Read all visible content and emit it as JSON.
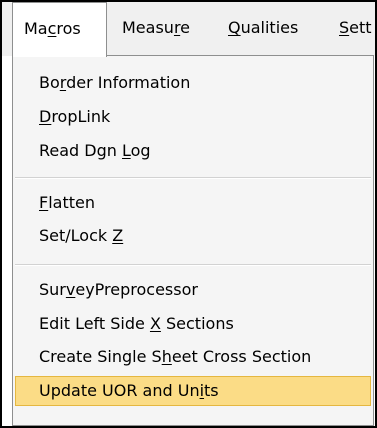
{
  "menubar": {
    "tabs": [
      {
        "pre": "Ma",
        "key": "c",
        "post": "ros"
      },
      {
        "pre": "Measu",
        "key": "r",
        "post": "e"
      },
      {
        "pre": "",
        "key": "Q",
        "post": "ualities"
      },
      {
        "pre": "",
        "key": "S",
        "post": "ett"
      }
    ]
  },
  "dropdown": {
    "items": [
      {
        "pre": "Bo",
        "key": "r",
        "post": "der Information"
      },
      {
        "pre": "",
        "key": "D",
        "post": "ropLink"
      },
      {
        "pre": "Read Dgn ",
        "key": "L",
        "post": "og"
      },
      {
        "pre": "",
        "key": "F",
        "post": "latten"
      },
      {
        "pre": "Set/Lock ",
        "key": "Z",
        "post": ""
      },
      {
        "pre": "Sur",
        "key": "v",
        "post": "eyPreprocessor"
      },
      {
        "pre": "Edit Left Side ",
        "key": "X",
        "post": " Sections"
      },
      {
        "pre": "Create Single S",
        "key": "h",
        "post": "eet Cross Section"
      },
      {
        "pre": "Update UOR and Un",
        "key": "i",
        "post": "ts"
      }
    ],
    "highlighted_index": 8
  },
  "colors": {
    "highlight_fill": "#fbdc86",
    "highlight_border": "#e5b740",
    "menu_background": "#f5f5f5",
    "menubar_background": "#f0f0f0"
  }
}
